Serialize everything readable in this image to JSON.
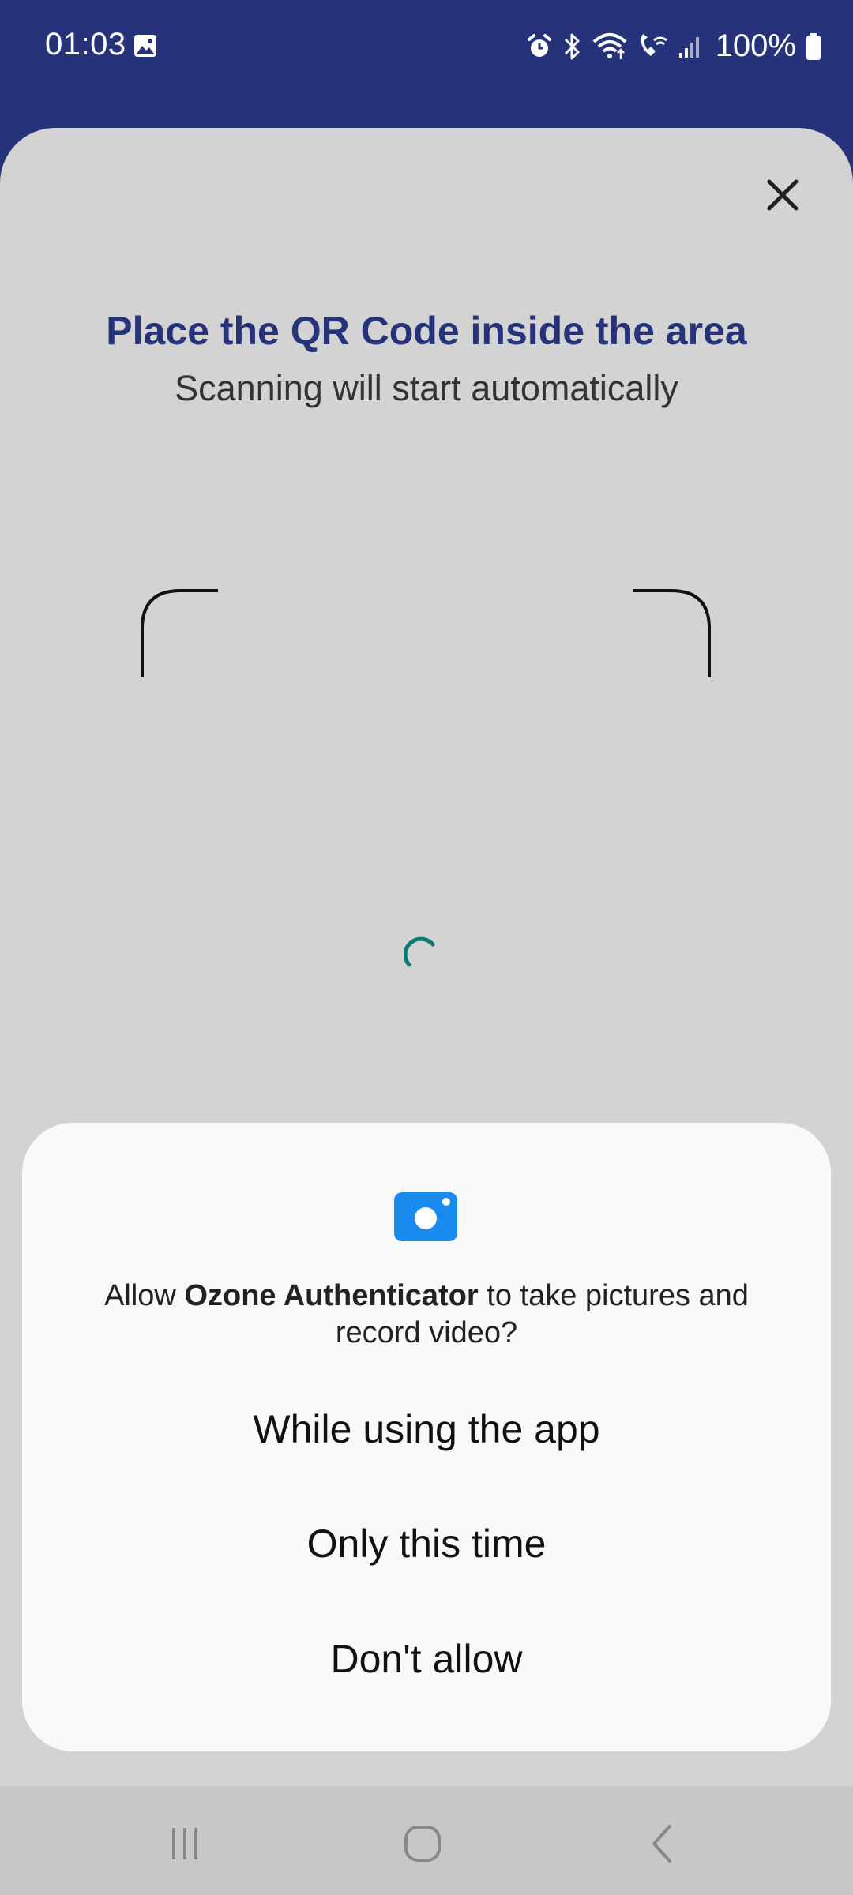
{
  "status_bar": {
    "time": "01:03",
    "battery": "100%",
    "icons": [
      "gallery-icon",
      "alarm-icon",
      "bluetooth-icon",
      "wifi-icon",
      "wifi-calling-icon",
      "signal-icon",
      "battery-icon"
    ]
  },
  "scanner": {
    "title": "Place the QR Code inside the area",
    "subtitle": "Scanning will start automatically"
  },
  "permission_dialog": {
    "prefix": "Allow ",
    "app_name": "Ozone Authenticator",
    "suffix": " to take pictures and record video?",
    "options": {
      "while_using": "While using the app",
      "only_this_time": "Only this time",
      "dont_allow": "Don't allow"
    }
  },
  "colors": {
    "brand": "#26337a",
    "spinner": "#0b7a70",
    "camera_icon": "#1a8cf0"
  }
}
